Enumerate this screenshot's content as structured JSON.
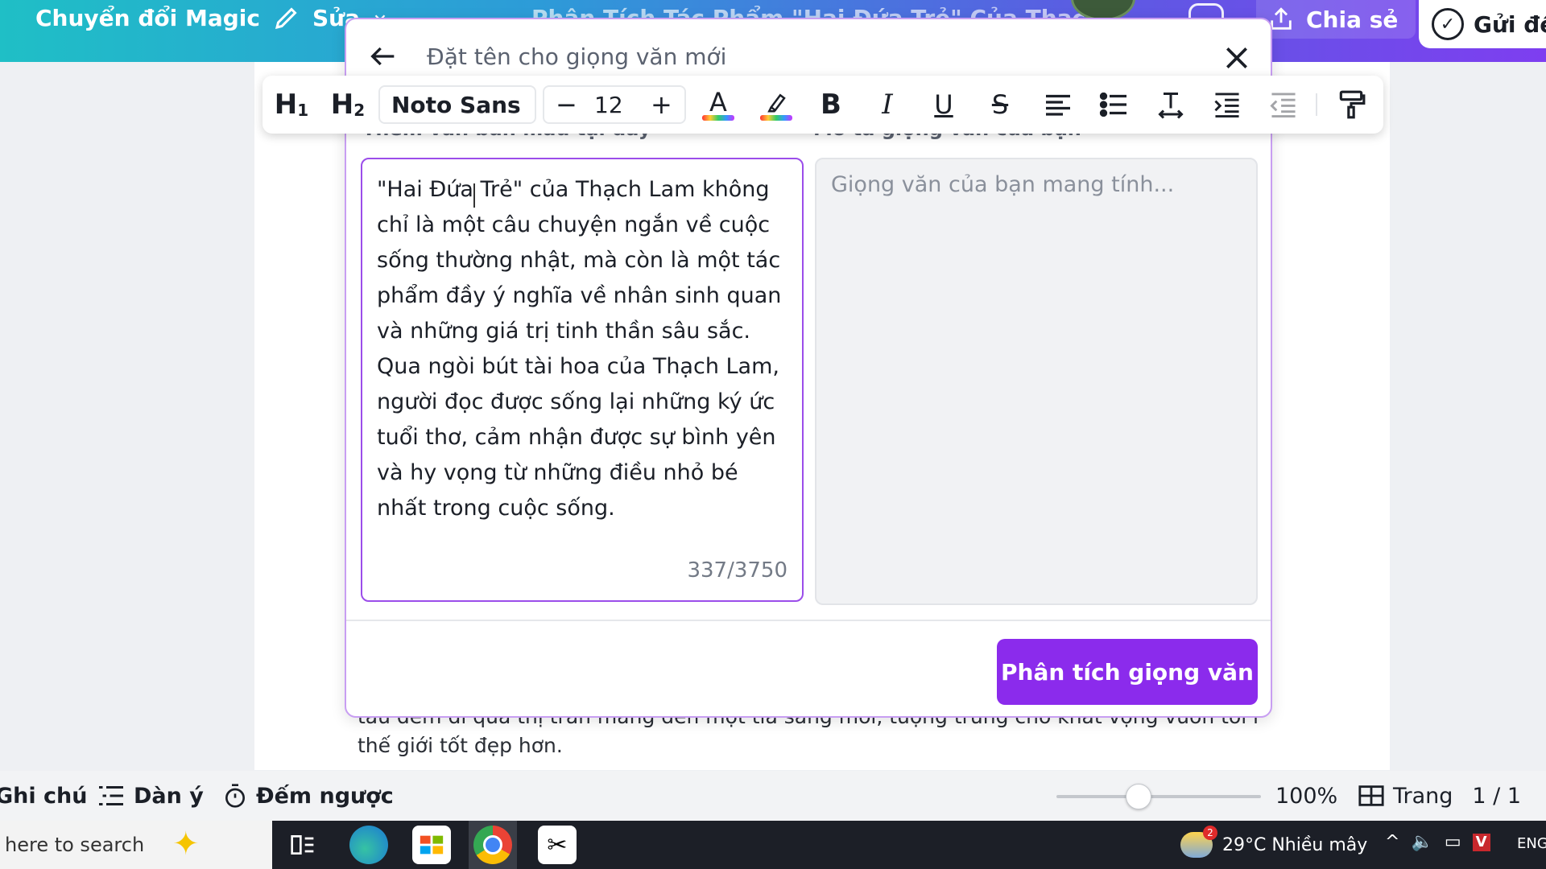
{
  "topbar": {
    "magic_label": "Chuyển đổi Magic",
    "edit_label": "Sửa",
    "doc_title": "Phân Tích Tác Phẩm \"Hai Đứa Trẻ\" Của Thạc",
    "share_label": "Chia sẻ",
    "send_label": "Gửi đế"
  },
  "document": {
    "line1": "tàu đêm đi qua thị trấn mang đến một tia sáng mới, tượng trưng cho khát vọng vươn tới một",
    "line2": "thế giới tốt đẹp hơn."
  },
  "modal": {
    "title": "Đặt tên cho giọng văn mới",
    "left_label": "Thêm văn bản mẫu tại đây",
    "right_label": "Mô tả giọng văn của bạn",
    "sample_text": "\"Hai Đứa Trẻ\" của Thạch Lam không chỉ là một câu chuyện ngắn về cuộc sống thường nhật, mà còn là một tác phẩm đầy ý nghĩa về nhân sinh quan và những giá trị tinh thần sâu sắc. Qua ngòi bút tài hoa của Thạch Lam, người đọc được sống lại những ký ức tuổi thơ, cảm nhận được sự bình yên và hy vọng từ những điều nhỏ bé nhất trong cuộc sống.",
    "char_count": "337/3750",
    "voice_placeholder": "Giọng văn của bạn mang tính...",
    "analyze_label": "Phân tích giọng văn"
  },
  "toolbar": {
    "h1": "H",
    "h1_sub": "1",
    "h2": "H",
    "h2_sub": "2",
    "font": "Noto Sans",
    "font_size": "12",
    "minus": "−",
    "plus": "+",
    "bold": "B",
    "italic": "I",
    "underline": "U",
    "strike": "S",
    "color_letter": "A"
  },
  "statusbar": {
    "notes": "Ghi chú",
    "outline": "Dàn ý",
    "timer": "Đếm ngược",
    "zoom": "100%",
    "page_label": "Trang",
    "page_value": "1 / 1",
    "zoom_level": 0.4
  },
  "taskbar": {
    "search_placeholder": "here to search",
    "weather": "29°C  Nhiều mây",
    "weather_badge": "2",
    "lang": "ENG",
    "tray_v": "V"
  },
  "colors": {
    "accent_purple": "#8b2bec",
    "border_purple": "#9b4dea",
    "topbar_start": "#1fbfc6",
    "topbar_end": "#7e3ef0"
  }
}
